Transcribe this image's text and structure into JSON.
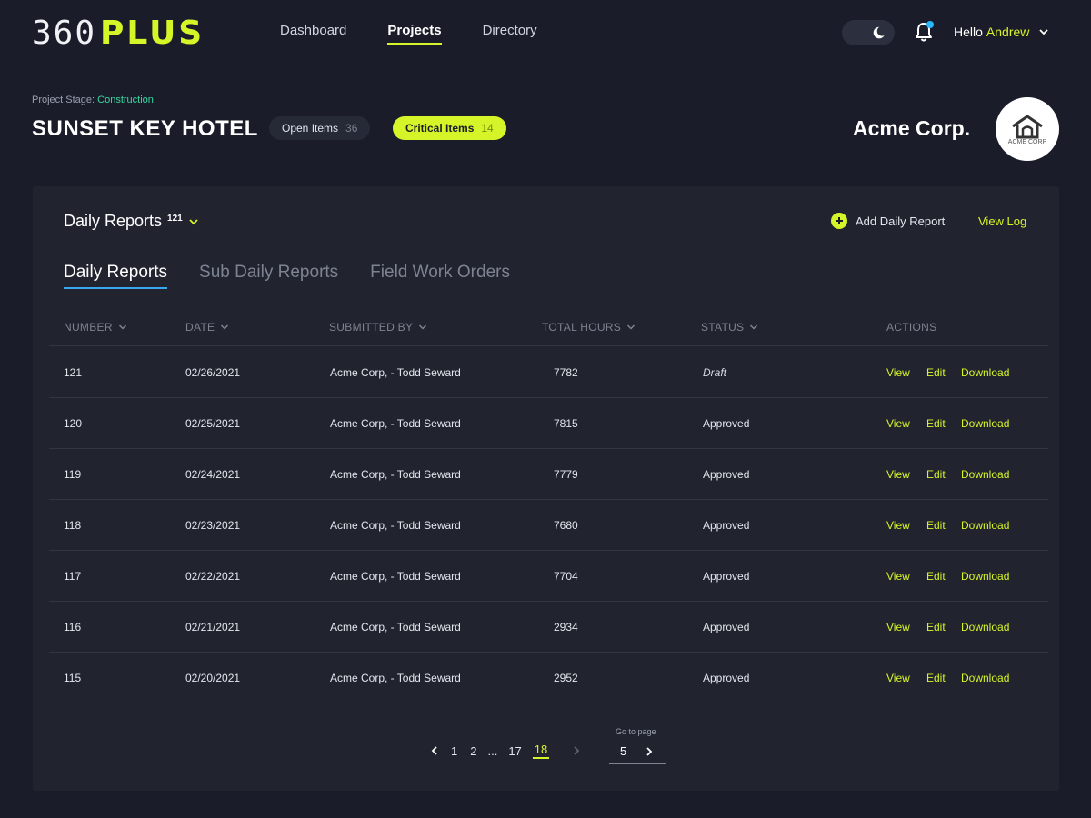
{
  "logo": {
    "part1": "360",
    "part2": "PLUS"
  },
  "nav": [
    {
      "label": "Dashboard",
      "active": false
    },
    {
      "label": "Projects",
      "active": true
    },
    {
      "label": "Directory",
      "active": false
    }
  ],
  "user": {
    "greeting": "Hello",
    "name": "Andrew"
  },
  "project": {
    "stage_label": "Project Stage:",
    "stage_value": "Construction",
    "title": "SUNSET KEY HOTEL",
    "open_items_label": "Open Items",
    "open_items_count": "36",
    "critical_items_label": "Critical Items",
    "critical_items_count": "14",
    "company": "Acme Corp.",
    "company_logo_text": "ACME CORP"
  },
  "panel": {
    "title": "Daily Reports",
    "count": "121",
    "add_label": "Add Daily Report",
    "view_log_label": "View Log",
    "tabs": [
      {
        "label": "Daily Reports",
        "active": true
      },
      {
        "label": "Sub Daily Reports",
        "active": false
      },
      {
        "label": "Field Work Orders",
        "active": false
      }
    ]
  },
  "table": {
    "headers": {
      "number": "NUMBER",
      "date": "DATE",
      "submitted_by": "SUBMITTED BY",
      "total_hours": "TOTAL HOURS",
      "status": "STATUS",
      "actions": "ACTIONS"
    },
    "actions": {
      "view": "View",
      "edit": "Edit",
      "download": "Download"
    },
    "rows": [
      {
        "number": "121",
        "date": "02/26/2021",
        "submitted_by": "Acme Corp, - Todd Seward",
        "hours": "7782",
        "status": "Draft"
      },
      {
        "number": "120",
        "date": "02/25/2021",
        "submitted_by": "Acme Corp, - Todd Seward",
        "hours": "7815",
        "status": "Approved"
      },
      {
        "number": "119",
        "date": "02/24/2021",
        "submitted_by": "Acme Corp, - Todd Seward",
        "hours": "7779",
        "status": "Approved"
      },
      {
        "number": "118",
        "date": "02/23/2021",
        "submitted_by": "Acme Corp, - Todd Seward",
        "hours": "7680",
        "status": "Approved"
      },
      {
        "number": "117",
        "date": "02/22/2021",
        "submitted_by": "Acme Corp, - Todd Seward",
        "hours": "7704",
        "status": "Approved"
      },
      {
        "number": "116",
        "date": "02/21/2021",
        "submitted_by": "Acme Corp, - Todd Seward",
        "hours": "2934",
        "status": "Approved"
      },
      {
        "number": "115",
        "date": "02/20/2021",
        "submitted_by": "Acme Corp, - Todd Seward",
        "hours": "2952",
        "status": "Approved"
      }
    ]
  },
  "pagination": {
    "pages": [
      "1",
      "2",
      "17",
      "18"
    ],
    "ellipsis": "...",
    "current": "18",
    "goto_label": "Go to page",
    "goto_value": "5"
  },
  "colors": {
    "background": "#1a1d29",
    "panel": "#21242f",
    "accent": "#d6f529",
    "stage": "#37d7a0",
    "tab_underline": "#3aa6ee",
    "notification": "#29b8ff"
  },
  "icons": [
    "moon-icon",
    "bell-icon",
    "chevron-down-icon",
    "plus-circle-icon",
    "chevron-left-icon",
    "chevron-right-icon",
    "house-logo-icon"
  ]
}
